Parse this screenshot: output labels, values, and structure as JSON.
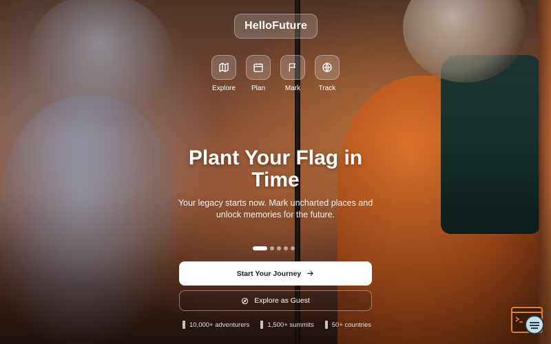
{
  "brand": {
    "name": "HelloFuture"
  },
  "nav": [
    {
      "label": "Explore",
      "icon": "map-icon"
    },
    {
      "label": "Plan",
      "icon": "calendar-icon"
    },
    {
      "label": "Mark",
      "icon": "flag-icon"
    },
    {
      "label": "Track",
      "icon": "globe-icon"
    }
  ],
  "hero": {
    "title": "Plant Your Flag in Time",
    "subtitle": "Your legacy starts now. Mark uncharted places and unlock memories for the future."
  },
  "carousel": {
    "slides": 5,
    "active_index": 0
  },
  "actions": {
    "primary_label": "Start Your Journey",
    "primary_icon": "arrow-right-icon",
    "secondary_label": "Explore as Guest",
    "secondary_icon": "compass-icon"
  },
  "stats": [
    {
      "label": "10,000+ adventurers"
    },
    {
      "label": "1,500+ summits"
    },
    {
      "label": "50+ countries"
    }
  ],
  "colors": {
    "accent": "#e2803a",
    "primary_button_bg": "#ffffff",
    "primary_button_text": "#1b1b1b"
  }
}
